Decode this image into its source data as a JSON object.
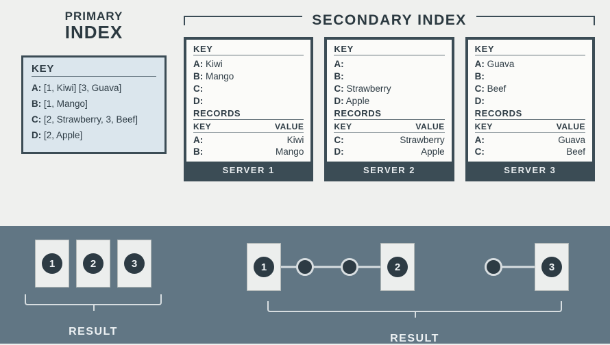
{
  "primary": {
    "title_line1": "PRIMARY",
    "title_line2": "INDEX",
    "key_heading": "KEY",
    "rows": [
      {
        "key": "A:",
        "value": "[1, Kiwi] [3, Guava]"
      },
      {
        "key": "B:",
        "value": "[1, Mango]"
      },
      {
        "key": "C:",
        "value": "[2, Strawberry, 3, Beef]"
      },
      {
        "key": "D:",
        "value": "[2, Apple]"
      }
    ]
  },
  "secondary": {
    "title": "SECONDARY INDEX",
    "key_heading": "KEY",
    "records_heading": "RECORDS",
    "records_key_col": "KEY",
    "records_val_col": "VALUE",
    "servers": [
      {
        "name": "SERVER 1",
        "keys": [
          {
            "key": "A:",
            "value": "Kiwi"
          },
          {
            "key": "B:",
            "value": "Mango"
          },
          {
            "key": "C:",
            "value": ""
          },
          {
            "key": "D:",
            "value": ""
          }
        ],
        "records": [
          {
            "key": "A:",
            "value": "Kiwi"
          },
          {
            "key": "B:",
            "value": "Mango"
          }
        ]
      },
      {
        "name": "SERVER 2",
        "keys": [
          {
            "key": "A:",
            "value": ""
          },
          {
            "key": "B:",
            "value": ""
          },
          {
            "key": "C:",
            "value": "Strawberry"
          },
          {
            "key": "D:",
            "value": "Apple"
          }
        ],
        "records": [
          {
            "key": "C:",
            "value": "Strawberry"
          },
          {
            "key": "D:",
            "value": "Apple"
          }
        ]
      },
      {
        "name": "SERVER 3",
        "keys": [
          {
            "key": "A:",
            "value": "Guava"
          },
          {
            "key": "B:",
            "value": ""
          },
          {
            "key": "C:",
            "value": "Beef"
          },
          {
            "key": "D:",
            "value": ""
          }
        ],
        "records": [
          {
            "key": "A:",
            "value": "Guava"
          },
          {
            "key": "C:",
            "value": "Beef"
          }
        ]
      }
    ]
  },
  "results": {
    "left_label": "RESULT",
    "right_label": "RESULT",
    "left_items": [
      "1",
      "2",
      "3"
    ],
    "right_items": [
      "1",
      "2",
      "3"
    ]
  }
}
